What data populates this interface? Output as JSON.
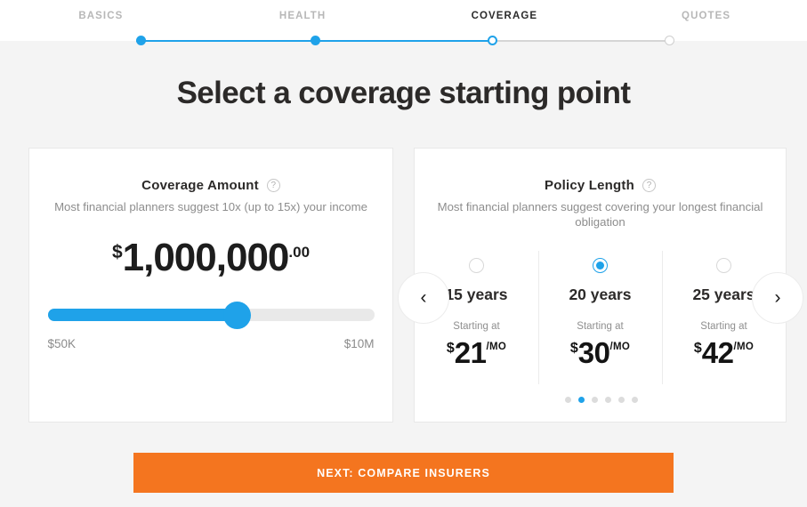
{
  "stepper": {
    "steps": [
      {
        "label": "BASICS",
        "state": "done"
      },
      {
        "label": "HEALTH",
        "state": "done"
      },
      {
        "label": "COVERAGE",
        "state": "current"
      },
      {
        "label": "QUOTES",
        "state": "upcoming"
      }
    ],
    "active_color": "#1fa2e9",
    "inactive_color": "#cfcfcf"
  },
  "page_title": "Select a coverage starting point",
  "coverage_card": {
    "title": "Coverage Amount",
    "help_icon": "question-circle-icon",
    "subtitle": "Most financial planners suggest 10x (up to 15x) your income",
    "amount": {
      "currency_symbol": "$",
      "value": "1,000,000",
      "cents": ".00"
    },
    "slider": {
      "min_label": "$50K",
      "max_label": "$10M",
      "fill_percent": 58,
      "fill_color": "#1fa2e9",
      "track_color": "#e9e9e9"
    }
  },
  "policy_card": {
    "title": "Policy Length",
    "help_icon": "question-circle-icon",
    "subtitle": "Most financial planners suggest covering your longest financial obligation",
    "starting_at_label": "Starting at",
    "per_month_label": "/MO",
    "currency_symbol": "$",
    "options": [
      {
        "years": "15 years",
        "price": "21",
        "selected": false
      },
      {
        "years": "20 years",
        "price": "30",
        "selected": true
      },
      {
        "years": "25 years",
        "price": "42",
        "selected": false
      }
    ],
    "prev_arrow": "‹",
    "next_arrow": "›",
    "carousel": {
      "total_dots": 6,
      "active_index": 1,
      "active_color": "#1fa2e9",
      "inactive_color": "#dcdcdc"
    }
  },
  "cta": {
    "label": "NEXT: COMPARE INSURERS",
    "color": "#f4751f"
  }
}
